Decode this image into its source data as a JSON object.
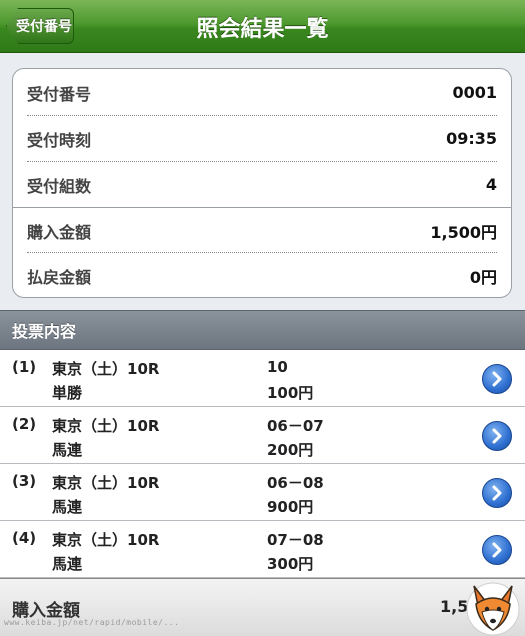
{
  "navbar": {
    "back_label": "受付番号",
    "title": "照会結果一覧"
  },
  "summary": {
    "rows": [
      {
        "label": "受付番号",
        "value": "0001"
      },
      {
        "label": "受付時刻",
        "value": "09:35"
      },
      {
        "label": "受付組数",
        "value": "4"
      },
      {
        "label": "購入金額",
        "value": "1,500円"
      },
      {
        "label": "払戻金額",
        "value": "0円"
      }
    ]
  },
  "section": {
    "title": "投票内容"
  },
  "tickets": [
    {
      "index": "(1)",
      "race": "東京（土）10R",
      "bet_type": "単勝",
      "combination": "10",
      "amount": "100円"
    },
    {
      "index": "(2)",
      "race": "東京（土）10R",
      "bet_type": "馬連",
      "combination": "06－07",
      "amount": "200円"
    },
    {
      "index": "(3)",
      "race": "東京（土）10R",
      "bet_type": "馬連",
      "combination": "06－08",
      "amount": "900円"
    },
    {
      "index": "(4)",
      "race": "東京（土）10R",
      "bet_type": "馬連",
      "combination": "07－08",
      "amount": "300円"
    }
  ],
  "footer": {
    "label": "購入金額",
    "value": "1,5"
  },
  "watermark": "www.keiba.jp/net/rapid/mobile/...",
  "colors": {
    "navbar_green": "#3a871f",
    "section_gray": "#6d7680",
    "disclosure_blue": "#2e6fd0"
  },
  "icons": {
    "disclosure": "chevron-right-circle-icon",
    "mascot": "fox-logo"
  }
}
